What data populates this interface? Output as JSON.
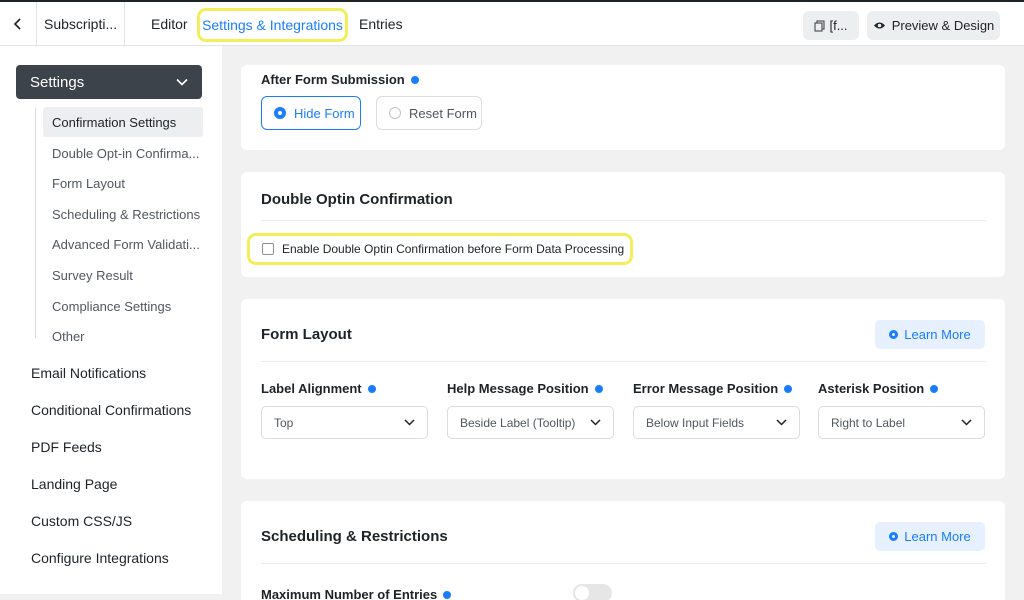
{
  "topbar": {
    "form_title": "Subscripti...",
    "tabs": [
      "Editor",
      "Settings & Integrations",
      "Entries"
    ],
    "shortcode_label": "[f...",
    "preview_label": "Preview & Design"
  },
  "sidebar": {
    "settings_label": "Settings",
    "sub_items": [
      "Confirmation Settings",
      "Double Opt-in Confirma...",
      "Form Layout",
      "Scheduling & Restrictions",
      "Advanced Form Validati...",
      "Survey Result",
      "Compliance Settings",
      "Other"
    ],
    "items": [
      "Email Notifications",
      "Conditional Confirmations",
      "PDF Feeds",
      "Landing Page",
      "Custom CSS/JS",
      "Configure Integrations"
    ]
  },
  "after_submission": {
    "label": "After Form Submission",
    "options": [
      "Hide Form",
      "Reset Form"
    ],
    "selected": "Hide Form"
  },
  "double_optin": {
    "title": "Double Optin Confirmation",
    "checkbox_label": "Enable Double Optin Confirmation before Form Data Processing",
    "checked": false
  },
  "form_layout": {
    "title": "Form Layout",
    "learn_more": "Learn More",
    "fields": [
      {
        "label": "Label Alignment",
        "value": "Top"
      },
      {
        "label": "Help Message Position",
        "value": "Beside Label (Tooltip)"
      },
      {
        "label": "Error Message Position",
        "value": "Below Input Fields"
      },
      {
        "label": "Asterisk Position",
        "value": "Right to Label"
      }
    ]
  },
  "scheduling": {
    "title": "Scheduling & Restrictions",
    "learn_more": "Learn More",
    "max_entries_label": "Maximum Number of Entries",
    "max_entries_enabled": false
  },
  "colors": {
    "accent": "#1a7efb",
    "highlight": "#f5ee5b",
    "sidebar_active": "#3c434a"
  }
}
